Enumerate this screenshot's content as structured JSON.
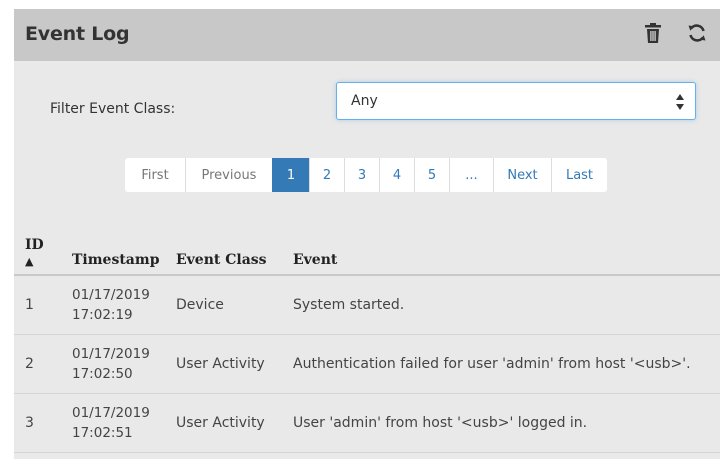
{
  "panel": {
    "title": "Event Log",
    "icons": {
      "delete": "trash-icon",
      "refresh": "refresh-icon"
    }
  },
  "filter": {
    "label": "Filter Event Class:",
    "selected": "Any"
  },
  "pagination": {
    "first": "First",
    "previous": "Previous",
    "pages": [
      "1",
      "2",
      "3",
      "4",
      "5",
      "..."
    ],
    "active_page": "1",
    "next": "Next",
    "last": "Last"
  },
  "table": {
    "headers": {
      "id": "ID",
      "id_sort": "▲",
      "timestamp": "Timestamp",
      "event_class": "Event Class",
      "event": "Event"
    },
    "rows": [
      {
        "id": "1",
        "date": "01/17/2019",
        "time": "17:02:19",
        "event_class": "Device",
        "event": "System started."
      },
      {
        "id": "2",
        "date": "01/17/2019",
        "time": "17:02:50",
        "event_class": "User Activity",
        "event": "Authentication failed for user 'admin' from host '<usb>'."
      },
      {
        "id": "3",
        "date": "01/17/2019",
        "time": "17:02:51",
        "event_class": "User Activity",
        "event": "User 'admin' from host '<usb>' logged in."
      }
    ]
  },
  "colors": {
    "header_bg": "#c8c8c8",
    "panel_bg": "#e9e9e9",
    "accent": "#337ab7"
  }
}
